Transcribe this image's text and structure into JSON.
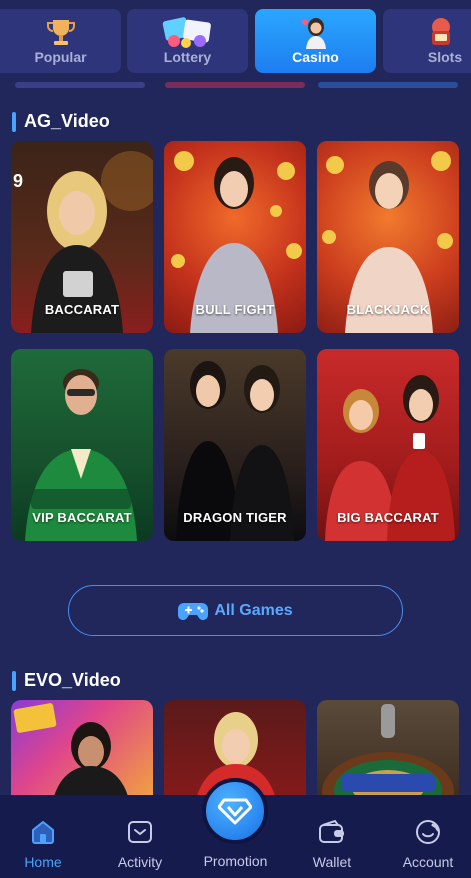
{
  "tabs": [
    {
      "label": "Popular",
      "icon": "trophy-icon",
      "active": false
    },
    {
      "label": "Lottery",
      "icon": "lottery-tickets-icon",
      "active": false
    },
    {
      "label": "Casino",
      "icon": "casino-dealer-icon",
      "active": true
    },
    {
      "label": "Slots",
      "icon": "slots-icon",
      "active": false
    }
  ],
  "sections": {
    "ag": {
      "title": "AG_Video",
      "games": [
        "BACCARAT",
        "BULL FIGHT",
        "BLACKJACK",
        "VIP BACCARAT",
        "DRAGON TIGER",
        "BIG BACCARAT"
      ]
    },
    "evo": {
      "title": "EVO_Video"
    }
  },
  "all_games": {
    "label": "All Games",
    "icon": "gamepad-icon"
  },
  "bottom_nav": {
    "home": "Home",
    "activity": "Activity",
    "promotion": "Promotion",
    "wallet": "Wallet",
    "account": "Account"
  },
  "colors": {
    "background": "#22275b",
    "accent": "#4aa3ff",
    "nav_background": "#151b4d"
  }
}
